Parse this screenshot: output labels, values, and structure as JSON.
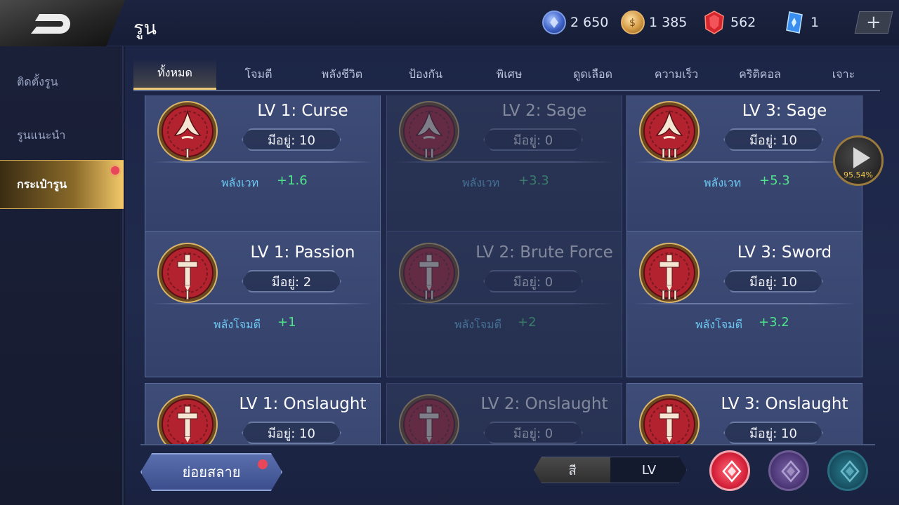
{
  "header": {
    "title": "รูน",
    "currencies": [
      {
        "name": "blue-coupon",
        "value": "2 650"
      },
      {
        "name": "gold-coin",
        "value": "1 385"
      },
      {
        "name": "red-gem",
        "value": "562"
      },
      {
        "name": "blue-card",
        "value": "1"
      }
    ],
    "plus_label": "+"
  },
  "sidebar": {
    "items": [
      {
        "label": "ติดตั้งรูน"
      },
      {
        "label": "รูนแนะนำ"
      },
      {
        "label": "กระเป๋ารูน"
      }
    ]
  },
  "tabs": [
    {
      "label": "ทั้งหมด"
    },
    {
      "label": "โจมตี"
    },
    {
      "label": "พลังชีวิต"
    },
    {
      "label": "ป้องกัน"
    },
    {
      "label": "พิเศษ"
    },
    {
      "label": "ดูดเลือด"
    },
    {
      "label": "ความเร็ว"
    },
    {
      "label": "คริติคอล"
    },
    {
      "label": "เจาะ"
    }
  ],
  "qty_prefix": "มีอยู่:",
  "runes": [
    {
      "title": "LV 1: Curse",
      "qty": "มีอยู่: 10",
      "stat": "พลังเวท",
      "value": "+1.6",
      "tier": "I",
      "icon": "curse"
    },
    {
      "title": "LV 2: Sage",
      "qty": "มีอยู่: 0",
      "stat": "พลังเวท",
      "value": "+3.3",
      "tier": "II",
      "icon": "curse"
    },
    {
      "title": "LV 3: Sage",
      "qty": "มีอยู่: 10",
      "stat": "พลังเวท",
      "value": "+5.3",
      "tier": "III",
      "icon": "curse"
    },
    {
      "title": "LV 1: Passion",
      "qty": "มีอยู่: 2",
      "stat": "พลังโจมตี",
      "value": "+1",
      "tier": "I",
      "icon": "sword"
    },
    {
      "title": "LV 2: Brute Force",
      "qty": "มีอยู่: 0",
      "stat": "พลังโจมตี",
      "value": "+2",
      "tier": "II",
      "icon": "sword"
    },
    {
      "title": "LV 3: Sword",
      "qty": "มีอยู่: 10",
      "stat": "พลังโจมตี",
      "value": "+3.2",
      "tier": "III",
      "icon": "sword"
    },
    {
      "title": "LV 1: Onslaught",
      "qty": "มีอยู่: 10",
      "stat": "",
      "value": "",
      "tier": "",
      "icon": "sword"
    },
    {
      "title": "LV 2: Onslaught",
      "qty": "มีอยู่: 0",
      "stat": "",
      "value": "",
      "tier": "",
      "icon": "sword"
    },
    {
      "title": "LV 3: Onslaught",
      "qty": "มีอยู่: 10",
      "stat": "",
      "value": "",
      "tier": "",
      "icon": "sword"
    }
  ],
  "play_button": {
    "percent": "95.54%"
  },
  "bottom": {
    "dismantle_label": "ย่อยสลาย",
    "sort_options": [
      "สี",
      "LV"
    ]
  },
  "colors": {
    "stat_name": "#6cc8f2",
    "stat_value": "#4ee58a",
    "active_tab_underline": "#e9c878",
    "rune_red": "#b3232f"
  }
}
